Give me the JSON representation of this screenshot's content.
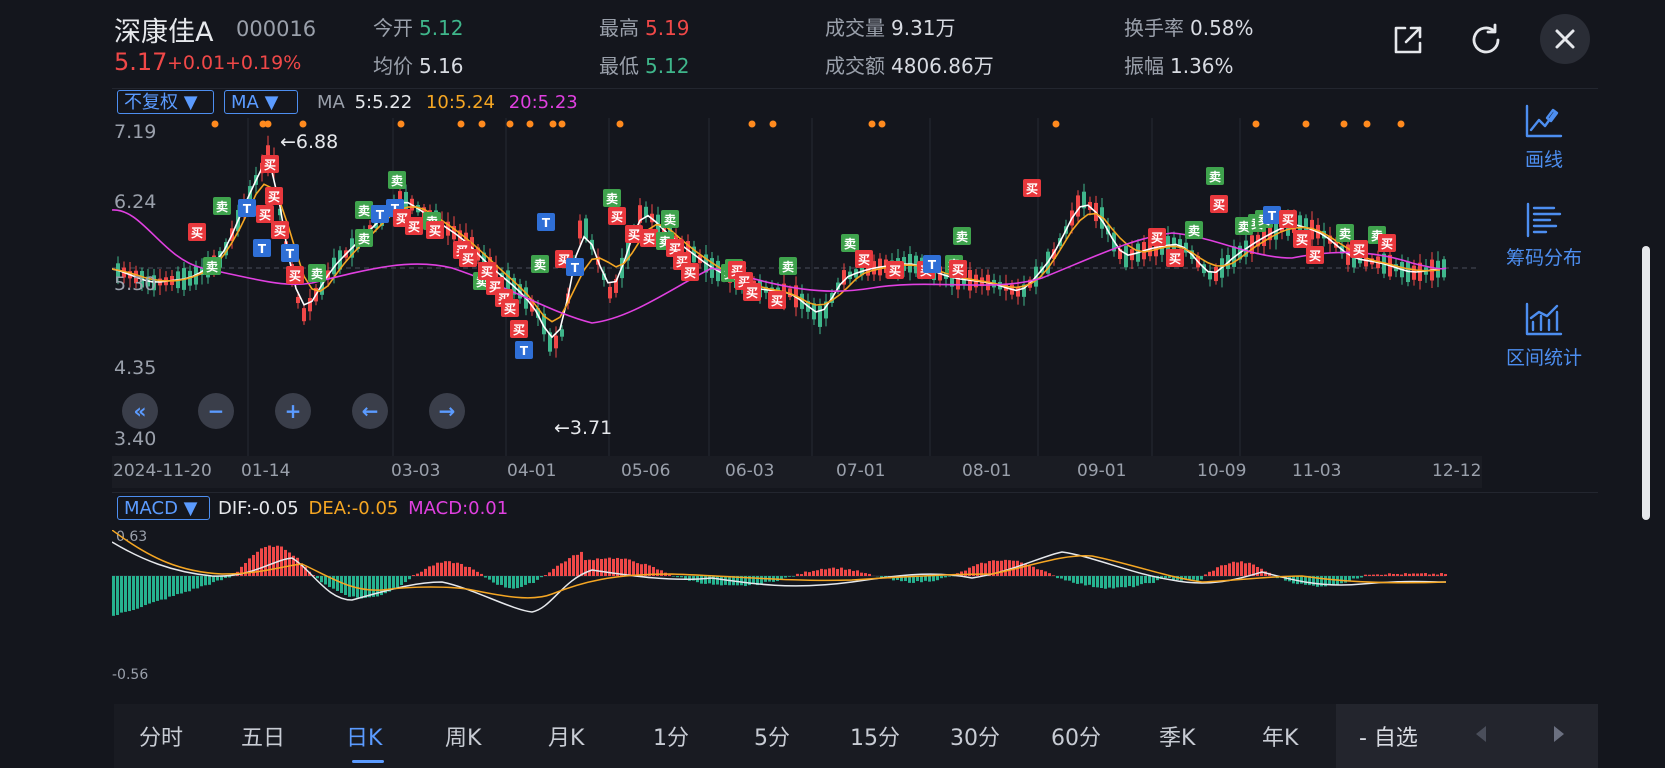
{
  "stock": {
    "name": "深康佳A",
    "code": "000016",
    "price": "5.17",
    "change": "+0.01",
    "change_pct": "+0.19%"
  },
  "stats": {
    "open_label": "今开",
    "open": "5.12",
    "high_label": "最高",
    "high": "5.19",
    "volume_label": "成交量",
    "volume": "9.31万",
    "turnover_label": "换手率",
    "turnover": "0.58%",
    "avg_label": "均价",
    "avg": "5.16",
    "low_label": "最低",
    "low": "5.12",
    "amount_label": "成交额",
    "amount": "4806.86万",
    "amplitude_label": "振幅",
    "amplitude": "1.36%"
  },
  "header_icons": [
    "external-link-icon",
    "refresh-icon",
    "close-icon"
  ],
  "main_chart": {
    "adjust_selector": "不复权 ▼",
    "indicator_selector": "MA ▼",
    "legend": {
      "prefix": "MA",
      "ma5": "5:5.22",
      "ma10": "10:5.24",
      "ma20": "20:5.23"
    },
    "y_ticks": [
      "7.19",
      "6.24",
      "5.30",
      "4.35",
      "3.40"
    ],
    "x_ticks": [
      "2024-11-20",
      "01-14",
      "03-03",
      "04-01",
      "05-06",
      "06-03",
      "07-01",
      "08-01",
      "09-01",
      "10-09",
      "11-03",
      "12-12"
    ],
    "high_annotation": "←6.88",
    "low_annotation": "←3.71",
    "marker_buy": "买",
    "marker_sell": "卖",
    "marker_t": "T",
    "colors": {
      "up": "#f04848",
      "down": "#3fb68b",
      "ma5": "#ffffff",
      "ma10": "#f5a623",
      "ma20": "#e040e0",
      "dot": "#ff8a1e"
    }
  },
  "macd": {
    "selector": "MACD ▼",
    "dif": "DIF:-0.05",
    "dea": "DEA:-0.05",
    "macd": "MACD:0.01",
    "y_top": "0.63",
    "y_bottom": "-0.56"
  },
  "zoom_controls": [
    "double-left-icon",
    "zoom-out-icon",
    "zoom-in-icon",
    "left-arrow-icon",
    "right-arrow-icon"
  ],
  "side_tools": [
    {
      "label": "画线",
      "icon": "draw-line-icon"
    },
    {
      "label": "筹码分布",
      "icon": "chip-distribution-icon"
    },
    {
      "label": "区间统计",
      "icon": "range-stats-icon"
    }
  ],
  "tabs": [
    "分时",
    "五日",
    "日K",
    "周K",
    "月K",
    "1分",
    "5分",
    "15分",
    "30分",
    "60分",
    "季K",
    "年K",
    "- 自选"
  ],
  "active_tab": "日K"
}
